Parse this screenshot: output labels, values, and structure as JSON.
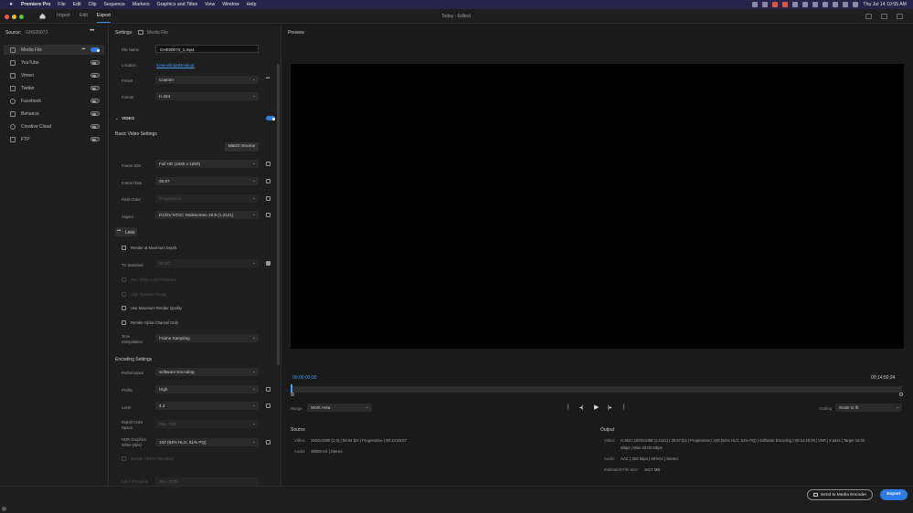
{
  "menubar": {
    "app_name": "Premiere Pro",
    "items": [
      "File",
      "Edit",
      "Clip",
      "Sequence",
      "Markers",
      "Graphics and Titles",
      "View",
      "Window",
      "Help"
    ],
    "clock": "Thu Jul 14  10:55 AM"
  },
  "appbar": {
    "tabs": [
      "Import",
      "Edit",
      "Export"
    ],
    "active_tab": "Export",
    "project_status": "Today - Edited"
  },
  "source": {
    "label": "Source:",
    "name": "GH020073",
    "destinations": [
      {
        "label": "Media File",
        "enabled": true
      },
      {
        "label": "YouTube",
        "enabled": false
      },
      {
        "label": "Vimeo",
        "enabled": false
      },
      {
        "label": "Twitter",
        "enabled": false
      },
      {
        "label": "Facebook",
        "enabled": false
      },
      {
        "label": "Behance",
        "enabled": false
      },
      {
        "label": "Creative Cloud",
        "enabled": false
      },
      {
        "label": "FTP",
        "enabled": false
      }
    ]
  },
  "settings": {
    "header": "Settings:",
    "header_target": "Media File",
    "file_name_label": "File Name",
    "file_name": "GH020073_1.mp4",
    "location_label": "Location",
    "location": "/Users/linda/Desktop",
    "preset_label": "Preset",
    "preset": "Custom",
    "format_label": "Format",
    "format": "H.264",
    "video_section": "VIDEO",
    "basic_video_settings": "Basic Video Settings",
    "match_source": "Match Source",
    "frame_size_label": "Frame Size",
    "frame_size": "Full HD (1920 x 1080)",
    "frame_rate_label": "Frame Rate",
    "frame_rate": "29.97",
    "field_order_label": "Field Order",
    "field_order": "Progressive",
    "aspect_label": "Aspect",
    "aspect": "D1/DV NTSC Widescreen 16:9 (1.2121)",
    "less": "Less",
    "render_max_depth": "Render at Maximum Depth",
    "tv_standard_label": "TV Standard",
    "tv_standard": "NTSC",
    "rec2020": "Rec. 2020 Color Primaries",
    "hdr": "High Dynamic Range",
    "max_render_quality": "Use Maximum Render Quality",
    "render_alpha": "Render Alpha Channel Only",
    "time_interp_label_1": "Time",
    "time_interp_label_2": "Interpolation",
    "time_interp": "Frame Sampling",
    "encoding_settings": "Encoding Settings",
    "performance_label": "Performance",
    "performance": "Software Encoding",
    "profile_label": "Profile",
    "profile": "High",
    "level_label": "Level",
    "level": "4.2",
    "export_color_space_label_1": "Export Color",
    "export_color_space_label_2": "Space",
    "export_color_space": "Rec. 709",
    "hdr_graphics_label_1": "HDR Graphics",
    "hdr_graphics_label_2": "White (Nits)",
    "hdr_graphics": "100 (63% HLG, 51% PQ)",
    "include_hdr10": "Include HDR10 Metadata",
    "color_primaries_label": "Color Primaries",
    "color_primaries": "Rec. 2020"
  },
  "preview": {
    "title": "Preview",
    "timecode_start": "00;00;00;00",
    "timecode_end": "00;14;50;24",
    "range_label": "Range",
    "range": "Work Area",
    "scaling_label": "Scaling",
    "scaling": "Scale to fit"
  },
  "source_info": {
    "title": "Source",
    "video_label": "Video:",
    "video": "1920x1080 (1.0)   |   59.94 fps   |   Progressive   |   00:14:49:57",
    "audio_label": "Audio:",
    "audio": "48000 Hz   |   Stereo"
  },
  "output_info": {
    "title": "Output",
    "video_label": "Video:",
    "video_line1": "H.264   |   1920x1080 (1.2121)   |   29.97 fps   |   Progressive   |   100 (63% HLG, 51% PQ)   |   Software Encoding   |   00:14:49:28   |   VBR   |   2 pass   |   Target 16.00",
    "video_line2": "Mbps   |   Max 40.00 Mbps",
    "audio_label": "Audio:",
    "audio": "AAC   |   320 kbps   |   48 kHz   |   Stereo",
    "file_size_label": "Estimated File Size:",
    "file_size": "1817 MB"
  },
  "footer": {
    "send_to_encoder": "Send to Media Encoder",
    "export": "Export"
  },
  "colors": {
    "accent": "#2d7be3",
    "timecode": "#4a9aff"
  }
}
